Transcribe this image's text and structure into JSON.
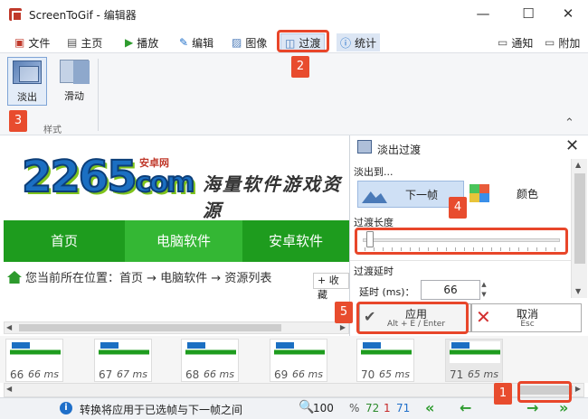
{
  "window": {
    "title": "ScreenToGif - 编辑器",
    "minimize": "—",
    "maximize": "☐",
    "close": "✕"
  },
  "tabs": [
    {
      "label": "文件",
      "icon": "save-icon"
    },
    {
      "label": "主页",
      "icon": "home-icon"
    },
    {
      "label": "播放",
      "icon": "play-icon"
    },
    {
      "label": "编辑",
      "icon": "pencil-icon"
    },
    {
      "label": "图像",
      "icon": "image-icon"
    },
    {
      "label": "过渡",
      "icon": "transition-icon",
      "active": true
    },
    {
      "label": "统计",
      "icon": "info-icon"
    }
  ],
  "right_actions": {
    "notify": "通知",
    "extras": "附加"
  },
  "ribbon": {
    "fade_label": "淡出",
    "slide_label": "滑动",
    "group_label": "样式"
  },
  "preview": {
    "logo": "2265",
    "logo_suffix": "com",
    "logo_tag": "安卓网",
    "slogan": "海量软件游戏资源",
    "nav": [
      "首页",
      "电脑软件",
      "安卓软件"
    ],
    "breadcrumb": "您当前所在位置：首页 → 电脑软件 → 资源列表",
    "collect": "+ 收藏"
  },
  "panel": {
    "title": "淡出过渡",
    "fade_to_label": "淡出到...",
    "next_frame": "下一帧",
    "color": "颜色",
    "length_label": "过渡长度",
    "delay_label": "过渡延时",
    "delay_field_label": "延时 (ms)：",
    "delay_value": "66",
    "apply": "应用",
    "apply_shortcut": "Alt + E / Enter",
    "cancel": "取消",
    "cancel_shortcut": "Esc"
  },
  "frames": [
    {
      "no": "66",
      "ms": "66 ms"
    },
    {
      "no": "67",
      "ms": "67 ms"
    },
    {
      "no": "68",
      "ms": "66 ms"
    },
    {
      "no": "69",
      "ms": "66 ms"
    },
    {
      "no": "70",
      "ms": "65 ms"
    },
    {
      "no": "71",
      "ms": "65 ms"
    }
  ],
  "status": {
    "text": "转换将应用于已选帧与下一帧之间",
    "zoom": "100",
    "percent": "%",
    "total": "72",
    "selected": "1",
    "current": "71"
  },
  "badges": [
    "1",
    "2",
    "3",
    "4",
    "5"
  ],
  "colors": {
    "accent": "#1f6fc9",
    "highlight": "#e8462a",
    "site_green": "#1e9c1e"
  }
}
